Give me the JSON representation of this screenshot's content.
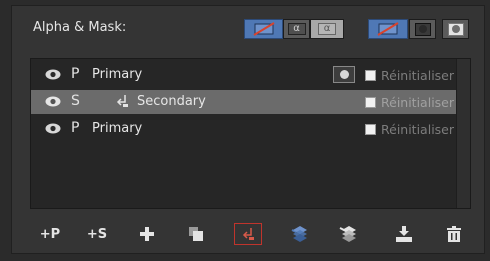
{
  "panel": {
    "label": "Alpha & Mask:",
    "mode_buttons": [
      {
        "icon": "no-alpha-icon",
        "state": "active"
      },
      {
        "icon": "alpha-icon",
        "glyph": "α",
        "state": "normal"
      },
      {
        "icon": "alpha-inverted-icon",
        "glyph": "α",
        "state": "disabled"
      },
      {
        "icon": "no-mask-icon",
        "state": "active"
      },
      {
        "icon": "mask-icon",
        "state": "normal"
      },
      {
        "icon": "mask-inverted-icon",
        "state": "normal"
      }
    ]
  },
  "rows": [
    {
      "type": "P",
      "name": "Primary",
      "reset_label": "Réinitialiser",
      "selected": false,
      "has_mask_button": true
    },
    {
      "type": "S",
      "name": "Secondary",
      "reset_label": "Réinitialiser",
      "selected": true,
      "has_mask_button": false
    },
    {
      "type": "P",
      "name": "Primary",
      "reset_label": "Réinitialiser",
      "selected": false,
      "has_mask_button": false
    }
  ],
  "toolbar": {
    "add_primary": "+P",
    "add_secondary": "+S",
    "icons": [
      "add-icon",
      "duplicate-icon",
      "link-secondary-icon",
      "layers-blue-icon",
      "layers-icon",
      "import-icon",
      "trash-icon"
    ]
  },
  "colors": {
    "accent_blue": "#4f78b5",
    "selected_row": "#6b6b6b",
    "active_outline": "#c0342c"
  }
}
